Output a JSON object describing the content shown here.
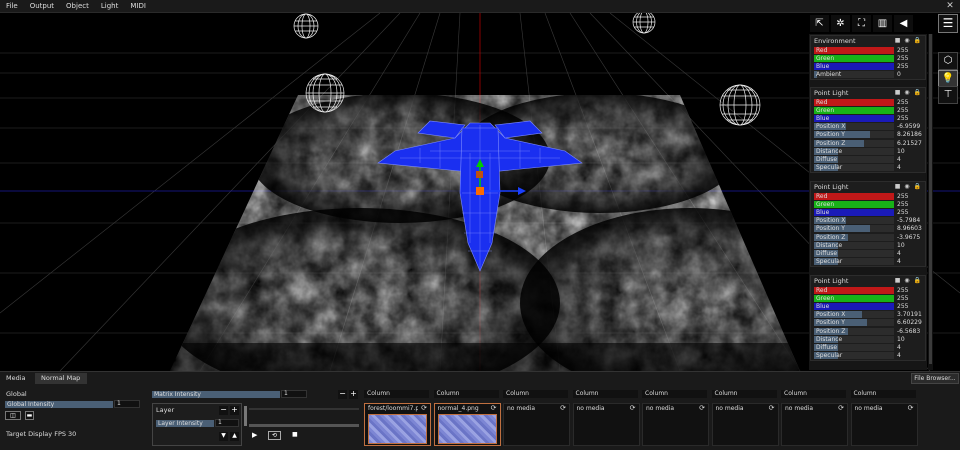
{
  "menubar": {
    "items": [
      "File",
      "Output",
      "Object",
      "Light",
      "MIDI"
    ],
    "close_glyph": "✕"
  },
  "toolbar": {
    "tools": [
      {
        "name": "select-tool-icon",
        "glyph": "⇱"
      },
      {
        "name": "rotate-tool-icon",
        "glyph": "✲"
      },
      {
        "name": "scale-tool-icon",
        "glyph": "⛶"
      },
      {
        "name": "texture-tool-icon",
        "glyph": "▥"
      },
      {
        "name": "cone-tool-icon",
        "glyph": "◀"
      }
    ],
    "menu_glyph": "☰",
    "side": [
      {
        "name": "cube-icon",
        "glyph": "⬡"
      },
      {
        "name": "light-bulb-icon",
        "glyph": "💡"
      },
      {
        "name": "projector-icon",
        "glyph": "⊤"
      }
    ]
  },
  "environment": {
    "title": "Environment",
    "icons": "■ ◉ 🔒",
    "rows": [
      {
        "label": "Red",
        "value": "255",
        "color": "red",
        "fill": 1.0
      },
      {
        "label": "Green",
        "value": "255",
        "color": "green",
        "fill": 1.0
      },
      {
        "label": "Blue",
        "value": "255",
        "color": "blue",
        "fill": 1.0
      },
      {
        "label": "Ambient",
        "value": "0",
        "color": "",
        "fill": 0.0
      }
    ]
  },
  "point_lights": [
    {
      "title": "Point Light",
      "icons": "■ ◉ 🔒",
      "rows": [
        {
          "label": "Red",
          "value": "255",
          "color": "red",
          "fill": 1.0
        },
        {
          "label": "Green",
          "value": "255",
          "color": "green",
          "fill": 1.0
        },
        {
          "label": "Blue",
          "value": "255",
          "color": "blue",
          "fill": 1.0
        },
        {
          "label": "Position X",
          "value": "-6.9599",
          "color": "",
          "fill": 0.4
        },
        {
          "label": "Position Y",
          "value": "8.26186",
          "color": "",
          "fill": 0.7
        },
        {
          "label": "Position Z",
          "value": "6.21527",
          "color": "",
          "fill": 0.63
        },
        {
          "label": "Distance",
          "value": "10",
          "color": "",
          "fill": 0.3
        },
        {
          "label": "Diffuse",
          "value": "4",
          "color": "",
          "fill": 0.3
        },
        {
          "label": "Specular",
          "value": "4",
          "color": "",
          "fill": 0.3
        }
      ]
    },
    {
      "title": "Point Light",
      "icons": "■ ◉ 🔒",
      "rows": [
        {
          "label": "Red",
          "value": "255",
          "color": "red",
          "fill": 1.0
        },
        {
          "label": "Green",
          "value": "255",
          "color": "green",
          "fill": 1.0
        },
        {
          "label": "Blue",
          "value": "255",
          "color": "blue",
          "fill": 1.0
        },
        {
          "label": "Position X",
          "value": "-5.7984",
          "color": "",
          "fill": 0.4
        },
        {
          "label": "Position Y",
          "value": "8.96603",
          "color": "",
          "fill": 0.7
        },
        {
          "label": "Position Z",
          "value": "-3.9675",
          "color": "",
          "fill": 0.42
        },
        {
          "label": "Distance",
          "value": "10",
          "color": "",
          "fill": 0.3
        },
        {
          "label": "Diffuse",
          "value": "4",
          "color": "",
          "fill": 0.3
        },
        {
          "label": "Specular",
          "value": "4",
          "color": "",
          "fill": 0.3
        }
      ]
    },
    {
      "title": "Point Light",
      "icons": "■ ◉ 🔒",
      "rows": [
        {
          "label": "Red",
          "value": "255",
          "color": "red",
          "fill": 1.0
        },
        {
          "label": "Green",
          "value": "255",
          "color": "green",
          "fill": 1.0
        },
        {
          "label": "Blue",
          "value": "255",
          "color": "blue",
          "fill": 1.0
        },
        {
          "label": "Position X",
          "value": "3.70191",
          "color": "",
          "fill": 0.6
        },
        {
          "label": "Position Y",
          "value": "6.60229",
          "color": "",
          "fill": 0.66
        },
        {
          "label": "Position Z",
          "value": "-6.5683",
          "color": "",
          "fill": 0.42
        },
        {
          "label": "Distance",
          "value": "10",
          "color": "",
          "fill": 0.3
        },
        {
          "label": "Diffuse",
          "value": "4",
          "color": "",
          "fill": 0.3
        },
        {
          "label": "Specular",
          "value": "4",
          "color": "",
          "fill": 0.3
        }
      ]
    }
  ],
  "bottom": {
    "tabs": [
      "Media",
      "Normal Map"
    ],
    "file_browser": "File Browser...",
    "global_label": "Global",
    "global_intensity_label": "Global Intensity",
    "global_intensity_value": "1",
    "global_intensity_fill": 1.0,
    "target_fps_label": "Target Display FPS",
    "target_fps_value": "30",
    "matrix_intensity_label": "Matrix Intensity",
    "matrix_intensity_value": "1",
    "matrix_intensity_fill": 1.0,
    "layer_label": "Layer",
    "layer_intensity_label": "Layer Intensity",
    "layer_intensity_value": "1",
    "minus": "−",
    "plus": "+",
    "down": "▼",
    "up": "▲",
    "play": "▶",
    "loop": "⟲",
    "stop": "■",
    "columns": [
      {
        "header": "Column",
        "media": "forest/loommi7.p",
        "has_thumb": true
      },
      {
        "header": "Column",
        "media": "normal_4.png",
        "has_thumb": true
      },
      {
        "header": "Column",
        "media": "no media",
        "has_thumb": false
      },
      {
        "header": "Column",
        "media": "no media",
        "has_thumb": false
      },
      {
        "header": "Column",
        "media": "no media",
        "has_thumb": false
      },
      {
        "header": "Column",
        "media": "no media",
        "has_thumb": false
      },
      {
        "header": "Column",
        "media": "no media",
        "has_thumb": false
      },
      {
        "header": "Column",
        "media": "no media",
        "has_thumb": false
      }
    ],
    "reload_glyph": "⟳"
  },
  "colors": {
    "red": "#c01818",
    "green": "#18b218",
    "blue": "#1a1ab8",
    "slider": "#4a5f75",
    "jet": "#1530ff"
  }
}
